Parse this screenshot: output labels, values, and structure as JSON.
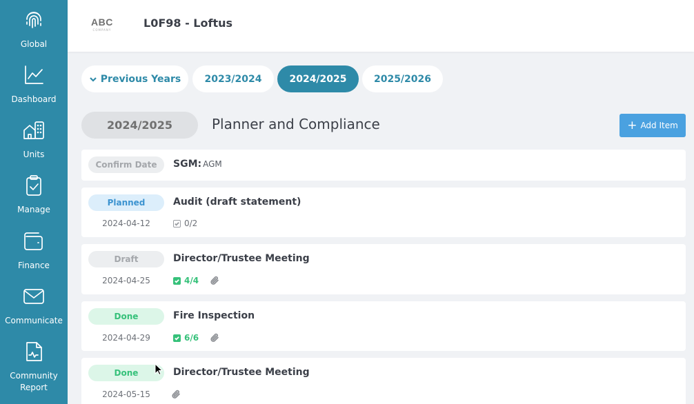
{
  "sidebar": {
    "items": [
      {
        "label": "Global",
        "icon": "fingerprint-icon"
      },
      {
        "label": "Dashboard",
        "icon": "line-chart-icon"
      },
      {
        "label": "Units",
        "icon": "buildings-icon"
      },
      {
        "label": "Manage",
        "icon": "clipboard-check-icon"
      },
      {
        "label": "Finance",
        "icon": "wallet-icon"
      },
      {
        "label": "Communicate",
        "icon": "envelope-icon"
      },
      {
        "label": "Community\nReport",
        "icon": "report-document-icon"
      }
    ]
  },
  "header": {
    "logo_text": "ABC",
    "logo_subtext": "COMPANY",
    "title": "L0F98 - Loftus"
  },
  "year_tabs": {
    "previous": "Previous Years",
    "tabs": [
      "2023/2024",
      "2024/2025",
      "2025/2026"
    ],
    "active": "2024/2025"
  },
  "section": {
    "year": "2024/2025",
    "title": "Planner and Compliance",
    "add_button": "Add Item"
  },
  "items": [
    {
      "status": "Confirm Date",
      "title": "SGM:",
      "subtitle": "AGM"
    },
    {
      "status": "Planned",
      "title": "Audit (draft statement)",
      "date": "2024-04-12",
      "checklist": "0/2"
    },
    {
      "status": "Draft",
      "title": "Director/Trustee Meeting",
      "date": "2024-04-25",
      "checklist": "4/4"
    },
    {
      "status": "Done",
      "title": "Fire Inspection",
      "date": "2024-04-29",
      "checklist": "6/6"
    },
    {
      "status": "Done",
      "title": "Director/Trustee Meeting",
      "date": "2024-05-15"
    }
  ],
  "colors": {
    "sidebar": "#2e8aa8",
    "accent": "#2e8aa8",
    "add_button": "#4aa1e0",
    "done": "#36c17a",
    "planned": "#3c93d0"
  }
}
